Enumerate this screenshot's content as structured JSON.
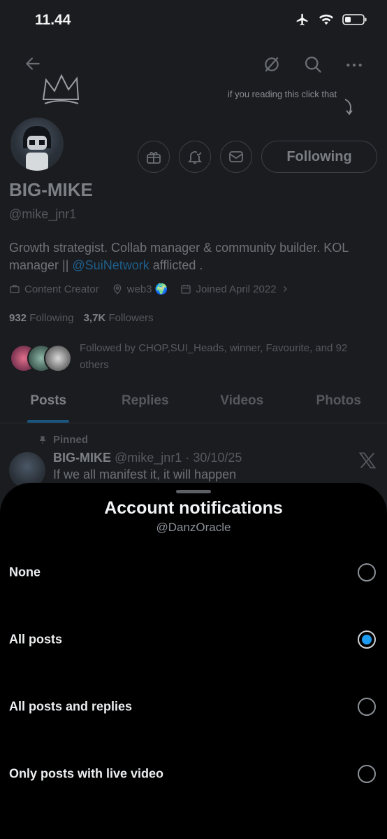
{
  "status_bar": {
    "time": "11.44"
  },
  "profile": {
    "hint_text": "if you reading this click that",
    "follow_button": "Following",
    "name": "BIG-MIKE",
    "handle": "@mike_jnr1",
    "bio_before": "Growth strategist. Collab manager & community builder. KOL manager || ",
    "bio_link": "@SuiNetwork",
    "bio_after": " afflicted .",
    "category": "Content Creator",
    "location": "web3 🌍",
    "joined": "Joined April 2022",
    "following_count": "932",
    "following_label": "Following",
    "followers_count": "3,7K",
    "followers_label": "Followers",
    "followed_by": "Followed by CHOP,SUI_Heads, winner, Favourite, and 92 others"
  },
  "tabs": [
    {
      "label": "Posts"
    },
    {
      "label": "Replies"
    },
    {
      "label": "Videos"
    },
    {
      "label": "Photos"
    }
  ],
  "pinned_post": {
    "pinned_label": "Pinned",
    "author": "BIG-MIKE",
    "meta": "@mike_jnr1 · 30/10/25",
    "text": "If we all manifest it, it will happen"
  },
  "sheet": {
    "title": "Account notifications",
    "subtitle": "@DanzOracle",
    "options": [
      {
        "label": "None",
        "checked": false
      },
      {
        "label": "All posts",
        "checked": true
      },
      {
        "label": "All posts and replies",
        "checked": false
      },
      {
        "label": "Only posts with live video",
        "checked": false
      }
    ],
    "accent": "#1d9bf0"
  }
}
